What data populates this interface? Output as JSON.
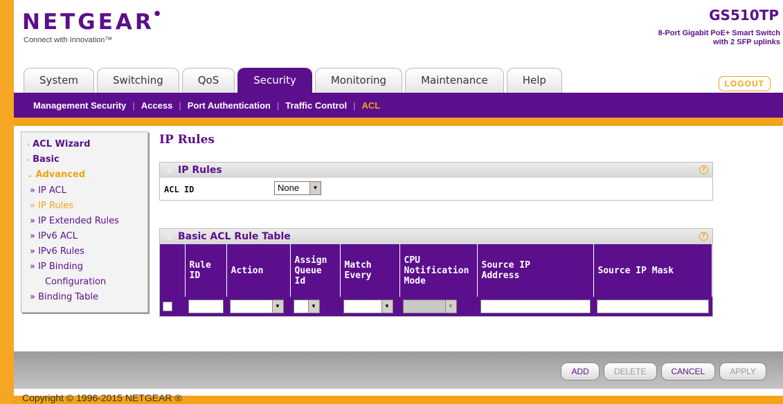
{
  "header": {
    "logo": "NETGEAR",
    "tagline": "Connect with Innovation™",
    "model": "GS510TP",
    "model_desc_line1": "8-Port Gigabit PoE+ Smart Switch",
    "model_desc_line2": "with 2 SFP uplinks",
    "logout": "LOGOUT"
  },
  "tabs": [
    {
      "label": "System"
    },
    {
      "label": "Switching"
    },
    {
      "label": "QoS"
    },
    {
      "label": "Security",
      "active": true
    },
    {
      "label": "Monitoring"
    },
    {
      "label": "Maintenance"
    },
    {
      "label": "Help"
    }
  ],
  "subnav": [
    {
      "label": "Management Security"
    },
    {
      "label": "Access"
    },
    {
      "label": "Port Authentication"
    },
    {
      "label": "Traffic Control"
    },
    {
      "label": "ACL",
      "active": true
    }
  ],
  "sidebar": {
    "acl_wizard": "ACL Wizard",
    "basic": "Basic",
    "advanced": "Advanced",
    "items": [
      {
        "label": "» IP ACL"
      },
      {
        "label": "» IP Rules",
        "active": true
      },
      {
        "label": "» IP Extended Rules"
      },
      {
        "label": "» IPv6 ACL"
      },
      {
        "label": "» IPv6 Rules"
      },
      {
        "label": "» IP Binding"
      },
      {
        "label": "Configuration"
      },
      {
        "label": "» Binding Table"
      }
    ]
  },
  "content": {
    "title": "IP Rules",
    "panel1_title": "IP Rules",
    "acl_id_label": "ACL ID",
    "acl_id_value": "None",
    "panel2_title": "Basic ACL Rule Table",
    "columns": [
      {
        "line1": "Rule",
        "line2": "ID",
        "line3": ""
      },
      {
        "line1": "Action",
        "line2": "",
        "line3": ""
      },
      {
        "line1": "Assign",
        "line2": "Queue",
        "line3": "Id"
      },
      {
        "line1": "Match",
        "line2": "Every",
        "line3": ""
      },
      {
        "line1": "CPU",
        "line2": "Notification",
        "line3": "Mode"
      },
      {
        "line1": "Source IP",
        "line2": "Address",
        "line3": ""
      },
      {
        "line1": "Source IP Mask",
        "line2": "",
        "line3": ""
      }
    ]
  },
  "actions": {
    "add": "ADD",
    "delete": "DELETE",
    "cancel": "CANCEL",
    "apply": "APPLY"
  },
  "footer": {
    "copyright": "Copyright © 1996-2015 NETGEAR ®"
  },
  "colors": {
    "brand_purple": "#5b0f8c",
    "accent_orange": "#f2a318"
  }
}
